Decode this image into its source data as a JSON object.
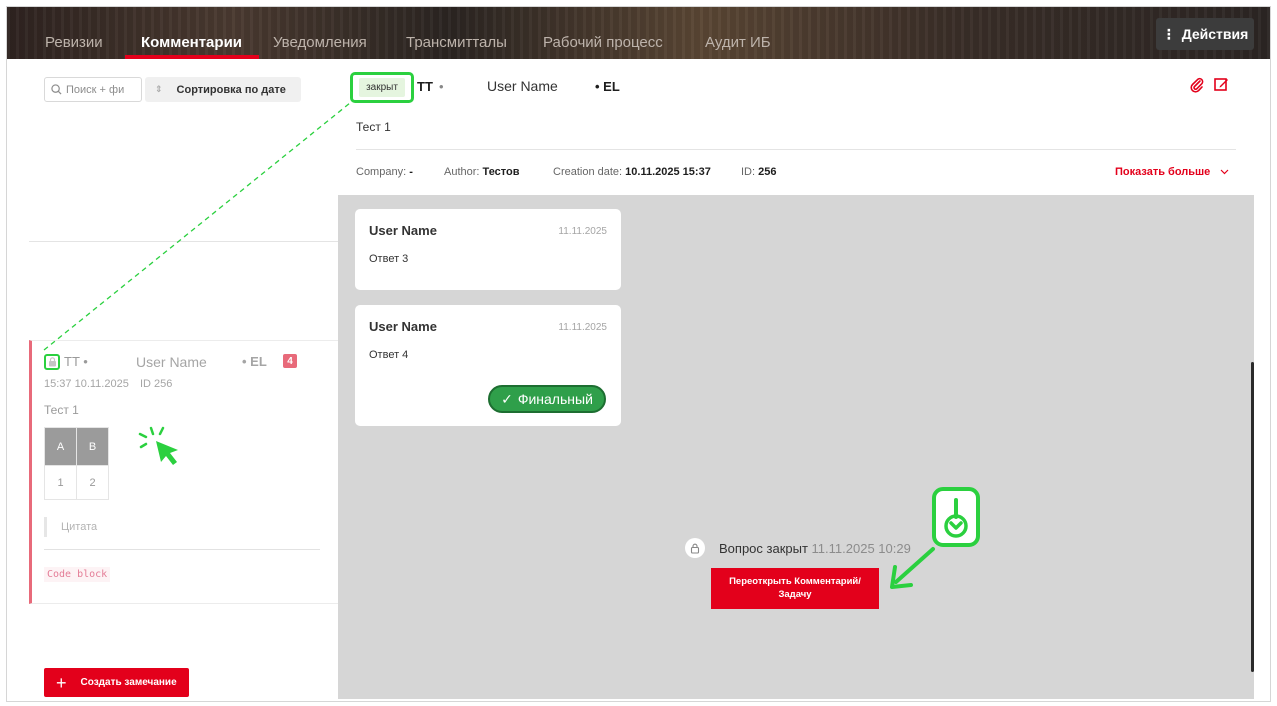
{
  "tabs": [
    {
      "label": "Ревизии",
      "active": false
    },
    {
      "label": "Комментарии",
      "active": true
    },
    {
      "label": "Уведомления",
      "active": false
    },
    {
      "label": "Трансмитталы",
      "active": false
    },
    {
      "label": "Рабочий процесс",
      "active": false
    },
    {
      "label": "Аудит ИБ",
      "active": false
    }
  ],
  "actions_label": "Действия",
  "sidebar": {
    "search_placeholder": "Поиск + фи",
    "sort_label": "Сортировка по дате",
    "create_label": "Создать замечание",
    "card": {
      "tt": "TT •",
      "user": "User Name",
      "el": "• EL",
      "count": "4",
      "time": "15:37 10.11.2025",
      "id": "ID 256",
      "text": "Тест 1",
      "table_headers": [
        "A",
        "B"
      ],
      "table_row": [
        "1",
        "2"
      ],
      "quote": "Цитата",
      "code": "Code block"
    }
  },
  "header": {
    "status": "закрыт",
    "tt": "TT",
    "dot": "•",
    "user": "User Name",
    "el": "• EL",
    "text": "Тест 1",
    "company_label": "Company:",
    "company_value": "-",
    "author_label": "Author:",
    "author_value": "Тестов",
    "created_label": "Creation date:",
    "created_value": "10.11.2025 15:37",
    "id_label": "ID:",
    "id_value": "256",
    "show_more": "Показать больше"
  },
  "replies": [
    {
      "user": "User Name",
      "date": "11.11.2025",
      "text": "Ответ 3"
    },
    {
      "user": "User Name",
      "date": "11.11.2025",
      "text": "Ответ 4",
      "badge": "Финальный"
    }
  ],
  "closed": {
    "label": "Вопрос закрыт",
    "date": "11.11.2025 10:29",
    "reopen_label": "Переоткрыть Комментарий/ Задачу"
  },
  "colors": {
    "accent": "#e3001b",
    "highlight": "#2bd03f",
    "final": "#2f9f4a"
  },
  "icons": [
    "search-icon",
    "sort-icon",
    "lock-icon",
    "paperclip-icon",
    "edit-icon",
    "chevron-down-icon",
    "check-icon",
    "plus-icon",
    "kebab-icon",
    "scroll-down-icon",
    "cursor-icon"
  ]
}
